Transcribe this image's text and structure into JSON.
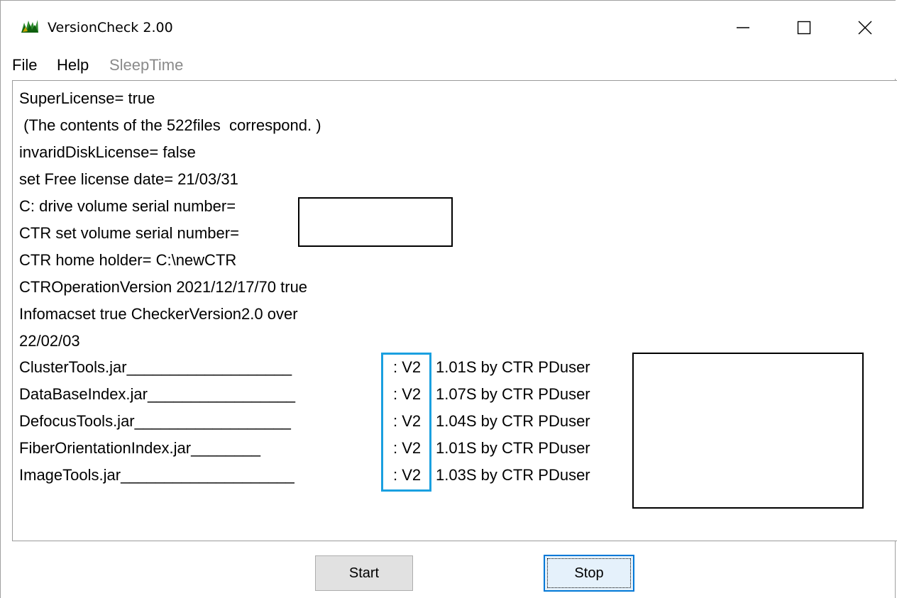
{
  "window": {
    "title": "VersionCheck 2.00",
    "accent_color": "#1aa0e0"
  },
  "menu": {
    "file": "File",
    "help": "Help",
    "sleep_time": "SleepTime"
  },
  "output": {
    "lines": [
      "SuperLicense= true",
      " (The contents of the 522files  correspond. )",
      "invaridDiskLicense= false",
      "set Free license date= 21/03/31",
      "C: drive volume serial number=",
      "CTR set volume serial number=",
      "CTR home holder= C:\\newCTR",
      "CTROperationVersion 2021/12/17/70 true",
      "Infomacset true CheckerVersion2.0 over",
      "22/02/03"
    ],
    "jars": [
      {
        "name": "ClusterTools.jar___________________",
        "ver": ": V2",
        "detail": "1.01S by CTR PDuser"
      },
      {
        "name": "DataBaseIndex.jar_________________",
        "ver": ": V2",
        "detail": "1.07S by CTR PDuser"
      },
      {
        "name": "DefocusTools.jar__________________",
        "ver": ": V2",
        "detail": "1.04S by CTR PDuser"
      },
      {
        "name": "FiberOrientationIndex.jar________",
        "ver": ": V2",
        "detail": "1.01S by CTR PDuser"
      },
      {
        "name": "ImageTools.jar____________________",
        "ver": ": V2",
        "detail": "1.03S by CTR PDuser"
      }
    ]
  },
  "buttons": {
    "start": "Start",
    "stop": "Stop"
  }
}
